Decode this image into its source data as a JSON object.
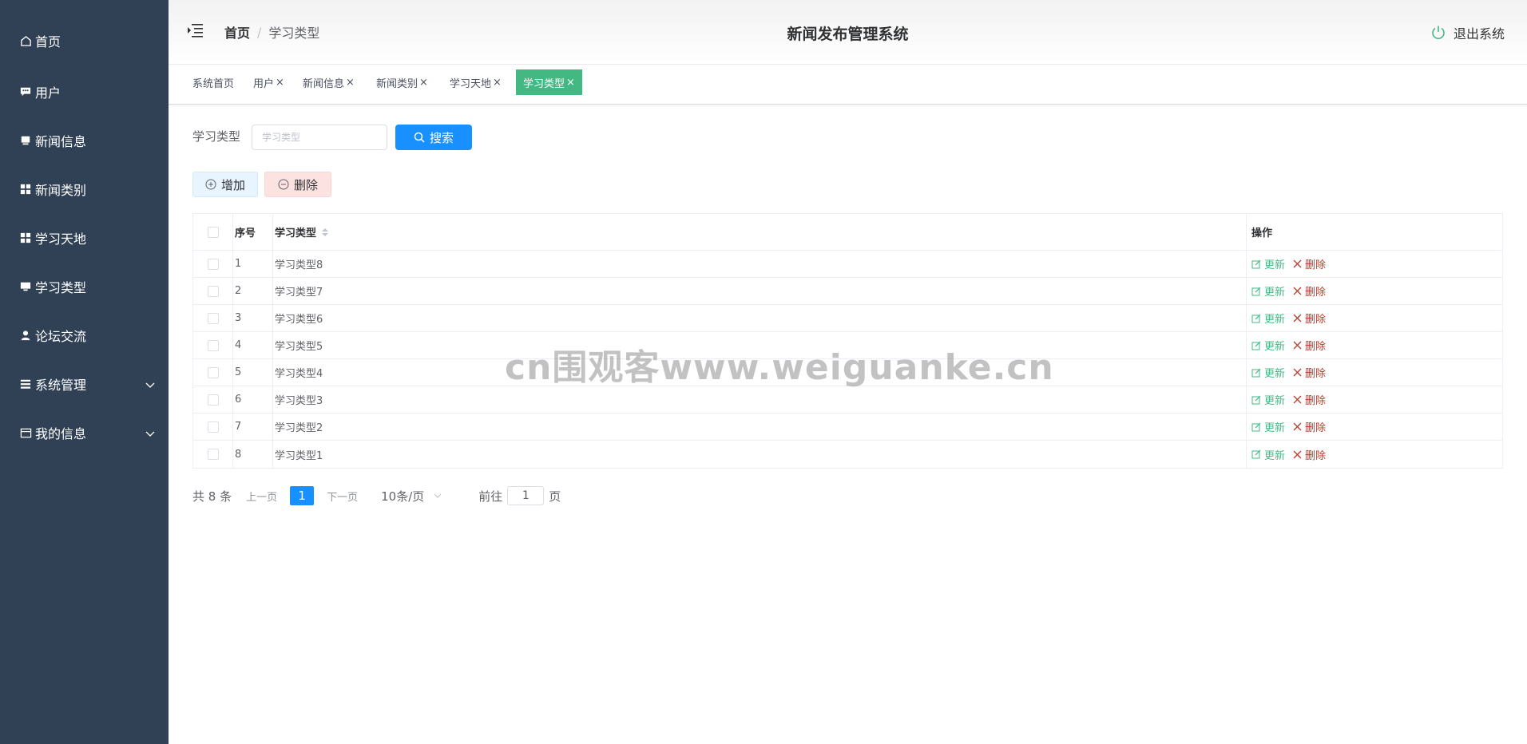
{
  "sidebar": {
    "items": [
      {
        "label": "首页",
        "icon": "home-icon"
      },
      {
        "label": "用户",
        "icon": "chat-icon"
      },
      {
        "label": "新闻信息",
        "icon": "news-icon"
      },
      {
        "label": "新闻类别",
        "icon": "grid-icon"
      },
      {
        "label": "学习天地",
        "icon": "grid-icon"
      },
      {
        "label": "学习类型",
        "icon": "monitor-icon"
      },
      {
        "label": "论坛交流",
        "icon": "user-icon"
      },
      {
        "label": "系统管理",
        "icon": "menu-icon",
        "expandable": true
      },
      {
        "label": "我的信息",
        "icon": "card-icon",
        "expandable": true
      }
    ]
  },
  "header": {
    "breadcrumb_home": "首页",
    "breadcrumb_sep": "/",
    "breadcrumb_current": "学习类型",
    "title": "新闻发布管理系统",
    "logout_label": "退出系统"
  },
  "tags": [
    {
      "label": "系统首页",
      "closable": false
    },
    {
      "label": "用户",
      "closable": true
    },
    {
      "label": "新闻信息",
      "closable": true
    },
    {
      "label": "新闻类别",
      "closable": true
    },
    {
      "label": "学习天地",
      "closable": true
    },
    {
      "label": "学习类型",
      "closable": true,
      "active": true
    }
  ],
  "tag_close": "×",
  "search": {
    "label": "学习类型",
    "placeholder": "学习类型",
    "value": "",
    "button_label": "搜索"
  },
  "actions": {
    "add_label": "增加",
    "delete_label": "删除"
  },
  "table": {
    "columns": [
      "序号",
      "学习类型",
      "操作"
    ],
    "rows": [
      {
        "no": "1",
        "type": "学习类型8"
      },
      {
        "no": "2",
        "type": "学习类型7"
      },
      {
        "no": "3",
        "type": "学习类型6"
      },
      {
        "no": "4",
        "type": "学习类型5"
      },
      {
        "no": "5",
        "type": "学习类型4"
      },
      {
        "no": "6",
        "type": "学习类型3"
      },
      {
        "no": "7",
        "type": "学习类型2"
      },
      {
        "no": "8",
        "type": "学习类型1"
      }
    ],
    "update_label": "更新",
    "delete_label": "删除"
  },
  "pagination": {
    "total": "共 8 条",
    "prev": "上一页",
    "page": "1",
    "next": "下一页",
    "page_size": "10条/页",
    "goto_label": "前往",
    "goto_value": "1",
    "page_unit": "页"
  },
  "watermark": "cn围观客www.weiguanke.cn",
  "colors": {
    "sidebar_bg": "#304156",
    "primary": "#1890ff",
    "active_tag": "#42b983",
    "update": "#42b983",
    "delete": "#c0392b"
  }
}
